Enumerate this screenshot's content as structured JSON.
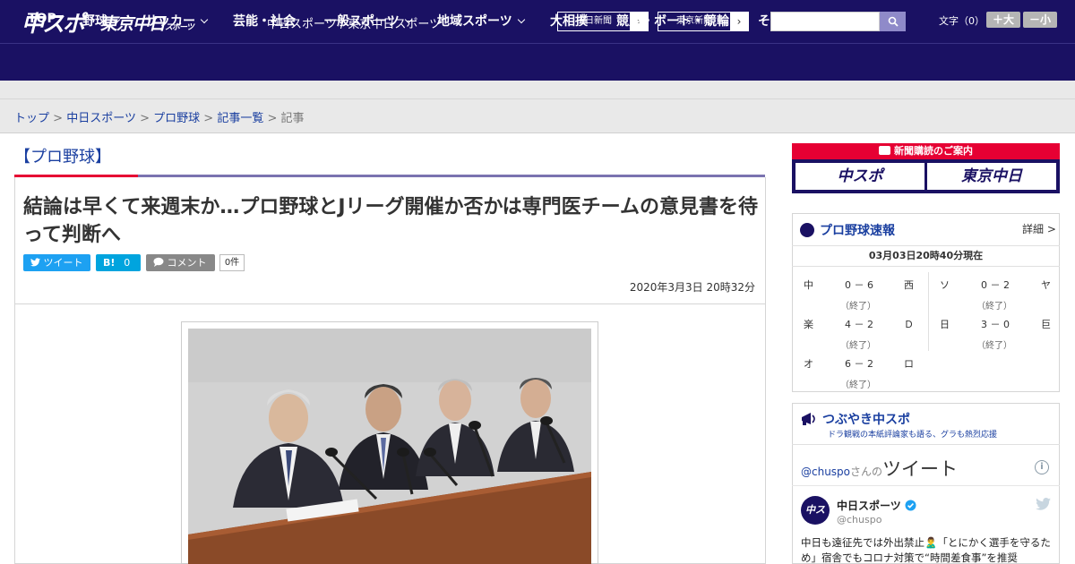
{
  "header": {
    "logo_main": "中スポ",
    "logo_tokyo": "東京中日",
    "logo_tokyo_small": "スポーツ",
    "site_links": "中日スポーツ / 東京中日スポーツ",
    "paper_buttons": [
      "中日新聞",
      "東京新聞"
    ],
    "search_placeholder": "",
    "font_size_label": "文字（0）",
    "font_plus": "＋大",
    "font_minus": "－小"
  },
  "nav": [
    {
      "label": "TOP",
      "has_menu": false
    },
    {
      "label": "野球",
      "has_menu": true
    },
    {
      "label": "サッカー",
      "has_menu": true
    },
    {
      "label": "芸能・社会",
      "has_menu": false
    },
    {
      "label": "一般スポーツ",
      "has_menu": true
    },
    {
      "label": "地域スポーツ",
      "has_menu": true
    },
    {
      "label": "大相撲",
      "has_menu": false
    },
    {
      "label": "競馬・ボート・競輪",
      "has_menu": false
    },
    {
      "label": "その他",
      "has_menu": true
    }
  ],
  "breadcrumb": {
    "items": [
      "トップ",
      "中日スポーツ",
      "プロ野球",
      "記事一覧"
    ],
    "current": "記事",
    "separator": ">"
  },
  "article": {
    "category": "【プロ野球】",
    "headline": "結論は早くて来週末か…プロ野球とJリーグ開催か否かは専門医チームの意見書を待って判断へ",
    "tweet_label": "ツイート",
    "hatena_label": "B!",
    "hatena_count": "0",
    "comment_label": "コメント",
    "comment_count": "0件",
    "date": "2020年3月3日 20時32分"
  },
  "sidebar": {
    "subscribe_title": "新聞購読のご案内",
    "subscribe_logos": [
      "中スポ",
      "東京中日"
    ],
    "scores": {
      "title": "プロ野球速報",
      "detail": "詳細 >",
      "time": "03月03日20時40分現在",
      "games": [
        {
          "home": "中",
          "score": "0 － 6",
          "status": "（終了）",
          "away": "西"
        },
        {
          "home": "ソ",
          "score": "0 － 2",
          "status": "（終了）",
          "away": "ヤ"
        },
        {
          "home": "楽",
          "score": "4 － 2",
          "status": "（終了）",
          "away": "Ｄ"
        },
        {
          "home": "日",
          "score": "3 － 0",
          "status": "（終了）",
          "away": "巨"
        },
        {
          "home": "オ",
          "score": "6 － 2",
          "status": "（終了）",
          "away": "ロ"
        }
      ]
    },
    "tweets": {
      "title": "つぶやき中スポ",
      "subtitle": "ドラ観戦の本紙評論家も語る、グラも熱烈応援",
      "user_handle": "@chuspo",
      "user_suffix": "さんの",
      "tweet_word": "ツイート",
      "name": "中日スポーツ",
      "handle": "@chuspo",
      "avatar_text": "中スポ",
      "text": "中日も遠征先では外出禁止🙎‍♂️「とにかく選手を守るため」宿舎でもコロナ対策で“時間差食事”を推奨"
    }
  },
  "colors": {
    "brand_navy": "#1a1163",
    "accent_red": "#e60033",
    "link_blue": "#1a3fa0",
    "twitter_blue": "#1da1f2"
  }
}
